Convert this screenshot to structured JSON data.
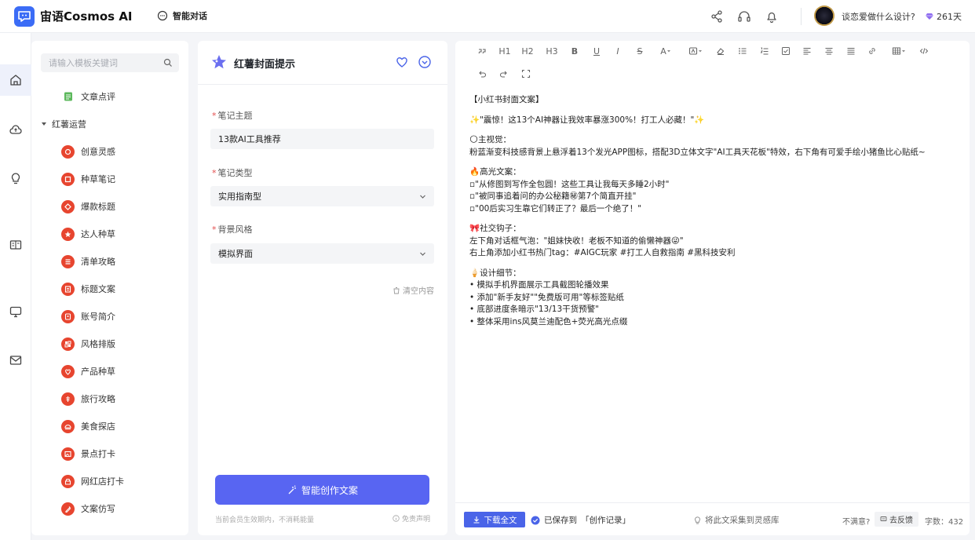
{
  "app": {
    "brand": "宙语Cosmos AI",
    "chat_tab": "智能对话"
  },
  "header": {
    "user_name": "谈恋爱做什么设计?",
    "days": "261天"
  },
  "sidebar": {
    "search_placeholder": "请输入模板关键词",
    "pre_item": "文章点评",
    "group": "红薯运营",
    "items": [
      "创意灵感",
      "种草笔记",
      "爆款标题",
      "达人种草",
      "清单攻略",
      "标题文案",
      "账号简介",
      "风格排版",
      "产品种草",
      "旅行攻略",
      "美食探店",
      "景点打卡",
      "网红店打卡",
      "文案仿写"
    ]
  },
  "form": {
    "title": "红薯封面提示",
    "topic_label": "笔记主题",
    "topic_value": "13款AI工具推荐",
    "type_label": "笔记类型",
    "type_value": "实用指南型",
    "style_label": "背景风格",
    "style_value": "模拟界面",
    "clear_label": "清空内容",
    "generate_label": "智能创作文案",
    "footer_left": "当前会员生效期内，不消耗能量",
    "footer_right": "免责声明"
  },
  "toolbar": {
    "h1": "H1",
    "h2": "H2",
    "h3": "H3",
    "bold": "B",
    "underline": "U",
    "italic": "I",
    "strike": "S",
    "font_color": "A"
  },
  "editor": {
    "lines": [
      [
        "【小红书封面文案】"
      ],
      [
        "✨\"震惊！这13个AI神器让我效率暴涨300%！打工人必藏！\"✨"
      ],
      [
        "🌕主视觉：",
        "粉蓝渐变科技感背景上悬浮着13个发光APP图标，搭配3D立体文字\"AI工具天花板\"特效，右下角有可爱手绘小猪鱼比心贴纸~"
      ],
      [
        "🔥高光文案：",
        "▫\"从修图到写作全包圆！这些工具让我每天多睡2小时\"",
        "▫\"被同事追着问的办公秘籍㊙第7个简直开挂\"",
        "▫\"00后实习生靠它们转正了？最后一个绝了！\""
      ],
      [
        "🎀社交钩子：",
        "左下角对话框气泡：\"姐妹快收！老板不知道的偷懒神器😜\"",
        "右上角添加小红书热门tag：#AIGC玩家 #打工人自救指南 #黑科技安利"
      ],
      [
        "🍦设计细节：",
        "• 模拟手机界面展示工具截图轮播效果",
        "• 添加\"新手友好\"\"免费版可用\"等标签贴纸",
        "• 底部进度条暗示\"13/13干货预警\"",
        "• 整体采用ins风莫兰迪配色+荧光高光点缀"
      ]
    ],
    "download_label": "下载全文",
    "saved_prefix": "已保存到",
    "saved_target": "「创作记录」",
    "collect_label": "将此文采集到灵感库",
    "unsatisfied": "不满意?",
    "feedback_label": "去反馈",
    "word_count": "字数：432"
  },
  "colors": {
    "accent": "#5865f2",
    "brand": "#3b6cf6",
    "template_icon": "#e7452f",
    "download": "#4a64e8"
  }
}
